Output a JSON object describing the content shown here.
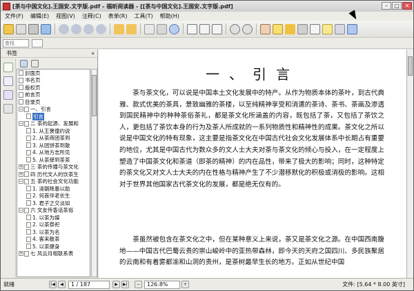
{
  "window": {
    "title": "[茶与中国文化].王国安.文字版.pdf - 福昕阅读器 - [[茶与中国文化].王国安.文字版.pdf]",
    "min": "–",
    "max": "□",
    "close": "✕"
  },
  "menu": [
    "文件(F)",
    "编辑(E)",
    "视图(V)",
    "注释(C)",
    "表单(R)",
    "工具(T)",
    "帮助(H)"
  ],
  "toolbar2": {
    "search_placeholder": "查找"
  },
  "sidebar": {
    "title": "书签",
    "collapse": "«",
    "tree": [
      {
        "label": "封面页",
        "indent": 1,
        "expander": "",
        "selected": false
      },
      {
        "label": "书名页",
        "indent": 1,
        "expander": "",
        "selected": false
      },
      {
        "label": "版权页",
        "indent": 1,
        "expander": "",
        "selected": false
      },
      {
        "label": "前言页",
        "indent": 1,
        "expander": "",
        "selected": false
      },
      {
        "label": "目录页",
        "indent": 1,
        "expander": "",
        "selected": false
      },
      {
        "label": "一、引言",
        "indent": 1,
        "expander": "−",
        "selected": false
      },
      {
        "label": "引言",
        "indent": 2,
        "expander": "",
        "selected": true
      },
      {
        "label": "二  茶的起源、发展和",
        "indent": 1,
        "expander": "−",
        "selected": false
      },
      {
        "label": "1. 从王褒僮约说",
        "indent": 2,
        "expander": "",
        "selected": false
      },
      {
        "label": "2. 从茶商团茶到",
        "indent": 2,
        "expander": "",
        "selected": false
      },
      {
        "label": "3. 从团饼茶到散",
        "indent": 2,
        "expander": "",
        "selected": false
      },
      {
        "label": "4. 从地方志所见",
        "indent": 2,
        "expander": "",
        "selected": false
      },
      {
        "label": "5. 从茶驿到茶茶",
        "indent": 2,
        "expander": "",
        "selected": false
      },
      {
        "label": "三  茶的传播与茶文化",
        "indent": 1,
        "expander": "+",
        "selected": false
      },
      {
        "label": "四  历代文人的饮茶生",
        "indent": 1,
        "expander": "+",
        "selected": false
      },
      {
        "label": "五  茶的社会文化功能",
        "indent": 1,
        "expander": "−",
        "selected": false
      },
      {
        "label": "1. 清朝降惠以助",
        "indent": 2,
        "expander": "",
        "selected": false
      },
      {
        "label": "2. 何首伴老长生",
        "indent": 2,
        "expander": "",
        "selected": false
      },
      {
        "label": "3. 君子之交淡如",
        "indent": 2,
        "expander": "",
        "selected": false
      },
      {
        "label": "六  文友传香话茶俗",
        "indent": 1,
        "expander": "−",
        "selected": false
      },
      {
        "label": "1. 以茶为媒",
        "indent": 2,
        "expander": "",
        "selected": false
      },
      {
        "label": "2. 以茶祭祀",
        "indent": 2,
        "expander": "",
        "selected": false
      },
      {
        "label": "3. 以茶为名",
        "indent": 2,
        "expander": "",
        "selected": false
      },
      {
        "label": "4. 客来敬茶",
        "indent": 2,
        "expander": "",
        "selected": false
      },
      {
        "label": "5. 以茶健身",
        "indent": 2,
        "expander": "",
        "selected": false
      },
      {
        "label": "七  风云月相联系表",
        "indent": 1,
        "expander": "+",
        "selected": false
      }
    ]
  },
  "document": {
    "heading": "一、引言",
    "paragraphs": [
      "茶与茶文化，可以说是中国本土文化发展中的特产。从作为物质本体的茶叶，到古代典雅、款式优美的茶具，景致幽雅的茶楼，以至纯精神享受和消遣的茶诗、茶书、茶画及渗透到国民精神中的种种茶俗茶礼，都是茶文化所涵盖的内容，既包括了茶，又包括了茶饮之人，更包括了茶饮本身的行为及茶人所成就的一系列物质性和精神性的成果。茶文化之所以说是中国文化的特有现象，这主要是指茶文化在中国古代社会文化发展体系中长期占有重要的地位，尤其是中国古代为数众多的文人士大夫对茶与茶文化的倾心与投入，在一定程度上塑造了中国茶文化和茶道（即茶的精神）的内在品性，带来了极大的影响；同时，这种特定的茶文化又对文人士大夫的内在性格与精神产生了不少潜移默化的积极或消极的影响。这相对于世界其他国家古代茶文化的发展，都是绝无仅有的。",
      "茶虽然被包含在茶文化之中，但在某种意义上来说，茶又是茶文化之源。在中国西南腹地——中国古代巴蜀云贵的崇山峻岭中的亚热带森林，即今天的天府之国四川、多民族聚居的云南和有着雾都渝和山洞的贵州，是茶树最早生长的地方。正如从世纪中国"
    ]
  },
  "status": {
    "ready": "就绪",
    "first": "|◀",
    "prev": "◀",
    "next": "▶",
    "last": "▶|",
    "page": "1 / 187",
    "zoom": "126.8%",
    "size": "文件: [5.64 * 8.00 英寸]"
  },
  "colors": {
    "selection": "#3a6fc4",
    "close_btn": "#d55555"
  }
}
